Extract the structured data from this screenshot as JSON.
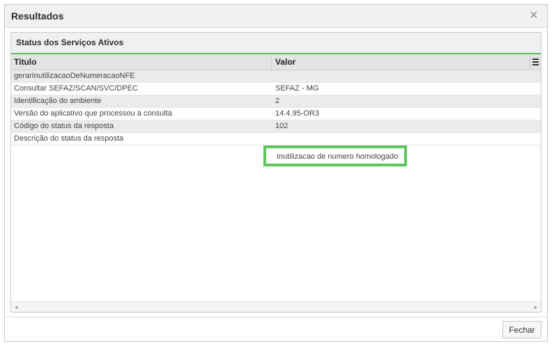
{
  "dialog": {
    "title": "Resultados",
    "close_symbol": "×"
  },
  "panel": {
    "title": "Status dos Serviços Ativos"
  },
  "grid": {
    "columns": {
      "title": "Titulo",
      "value": "Valor"
    },
    "rows": [
      {
        "title": "gerarInutilizacaoDeNumeracaoNFE",
        "value": ""
      },
      {
        "title": "Consultar SEFAZ/SCAN/SVC/DPEC",
        "value": "SEFAZ - MG"
      },
      {
        "title": "Identificação do ambiente",
        "value": "2"
      },
      {
        "title": "Versão do aplicativo que processou a consulta",
        "value": "14.4.95-OR3"
      },
      {
        "title": "Código do status da resposta",
        "value": "102"
      },
      {
        "title": "Descrição do status da resposta",
        "value": "Inutilizacao de numero homologado"
      }
    ]
  },
  "footer": {
    "close_label": "Fechar"
  },
  "colors": {
    "accent_green": "#5cc55c"
  },
  "icons": {
    "menu": "hamburger-icon",
    "scroll_left": "◂",
    "scroll_right": "▸"
  }
}
